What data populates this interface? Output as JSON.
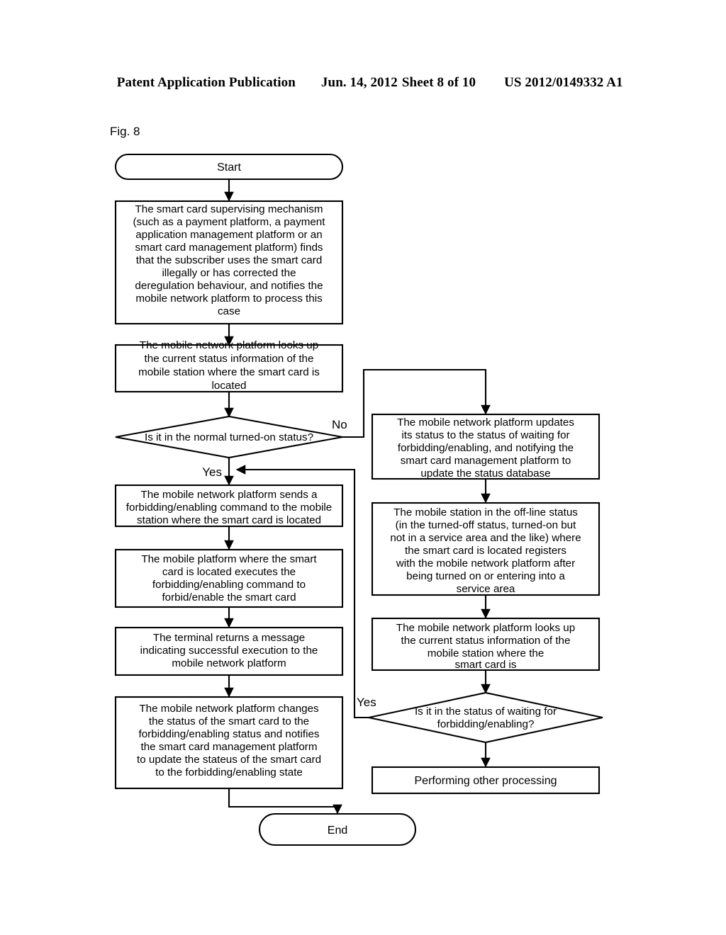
{
  "header": {
    "publication": "Patent Application Publication",
    "date": "Jun. 14, 2012",
    "sheet": "Sheet 8 of 10",
    "number": "US 2012/0149332 A1"
  },
  "figure": {
    "label": "Fig. 8"
  },
  "nodes": {
    "start": {
      "label": "Start",
      "shape": "terminator"
    },
    "end": {
      "label": "End",
      "shape": "terminator"
    },
    "box_supervising": {
      "shape": "process",
      "lines": [
        "The smart card supervising mechanism",
        "(such as a payment platform, a payment",
        "application management platform or an",
        "smart card management platform) finds",
        "that the subscriber uses the smart card",
        "illegally or has corrected the",
        "deregulation behaviour, and notifies the",
        "mobile network platform to process this",
        "case"
      ]
    },
    "box_lookup_left": {
      "shape": "process",
      "lines": [
        "The mobile network platform looks up",
        "the current status information of the",
        "mobile station where the smart card is",
        "located"
      ]
    },
    "decision_turned_on": {
      "shape": "decision",
      "lines": [
        "Is it in the normal turned-on status?"
      ]
    },
    "box_send_command": {
      "shape": "process",
      "lines": [
        "The mobile network platform sends a",
        "forbidding/enabling command to the mobile",
        "station where the smart card is located"
      ]
    },
    "box_execute_command": {
      "shape": "process",
      "lines": [
        "The mobile platform where the smart",
        "card is located executes the",
        "forbidding/enabling command to",
        "forbid/enable the smart card"
      ]
    },
    "box_terminal_returns": {
      "shape": "process",
      "lines": [
        "The terminal returns a message",
        "indicating successful execution  to the",
        "mobile network platform"
      ]
    },
    "box_change_status": {
      "shape": "process",
      "lines": [
        "The mobile network platform changes",
        "the status of the smart card to the",
        "forbidding/enabling status and notifies",
        "the smart card management platform",
        "to update the stateus of the smart card",
        "to the forbidding/enabling state"
      ]
    },
    "box_update_waiting": {
      "shape": "process",
      "lines": [
        "The mobile network platform updates",
        "its status to the status of waiting for",
        "forbidding/enabling, and notifying the",
        "smart card management platform to",
        "update the status database"
      ]
    },
    "box_offline_registers": {
      "shape": "process",
      "lines": [
        "The mobile station in the off-line status",
        "(in the turned-off status, turned-on but",
        "not in a service area and the like) where",
        "the smart card is located registers",
        "with the mobile network platform after",
        "being turned on or entering into a",
        "service area"
      ]
    },
    "box_lookup_right": {
      "shape": "process",
      "lines": [
        "The mobile network platform looks up",
        "the current status information of the",
        "mobile station where the",
        "smart card is"
      ]
    },
    "decision_waiting": {
      "shape": "decision",
      "lines": [
        "Is it in the status of waiting for",
        "forbidding/enabling?"
      ]
    },
    "box_other_processing": {
      "shape": "process",
      "lines": [
        "Performing other processing"
      ]
    }
  },
  "edge_labels": {
    "no_branch": "No",
    "yes_branch": "Yes",
    "yes_return": "Yes"
  },
  "colors": {
    "stroke": "#000000",
    "fill": "#ffffff",
    "text": "#000000"
  }
}
